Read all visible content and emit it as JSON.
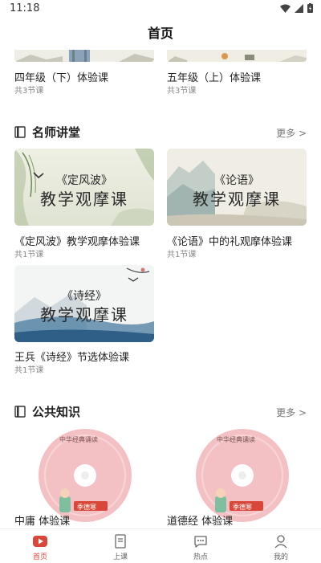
{
  "status": {
    "time": "11:18"
  },
  "header": {
    "title": "首页"
  },
  "top_cards": [
    {
      "title": "四年级（下）体验课",
      "sub": "共3节课"
    },
    {
      "title": "五年级（上）体验课",
      "sub": "共3节课"
    }
  ],
  "section1": {
    "name": "名师讲堂",
    "more": "更多 >",
    "cards": [
      {
        "poem": "《定风波》",
        "caption": "教学观摩课",
        "title": "《定风波》教学观摩体验课",
        "sub": "共1节课"
      },
      {
        "poem": "《论语》",
        "caption": "教学观摩课",
        "title": "《论语》中的礼观摩体验课",
        "sub": "共1节课"
      },
      {
        "poem": "《诗经》",
        "caption": "教学观摩课",
        "title": "王兵《诗经》节选体验课",
        "sub": "共1节课"
      }
    ]
  },
  "section2": {
    "name": "公共知识",
    "more": "更多 >",
    "cards": [
      {
        "title": "中庸 体验课",
        "disc_text": "中华经典诵读",
        "badge": "季德寒"
      },
      {
        "title": "道德经 体验课",
        "disc_text": "中华经典诵读",
        "badge": "季德寒"
      }
    ]
  },
  "nav": [
    {
      "label": "首页",
      "icon": "play-icon",
      "active": true
    },
    {
      "label": "上课",
      "icon": "book-icon"
    },
    {
      "label": "热点",
      "icon": "chat-icon"
    },
    {
      "label": "我的",
      "icon": "user-icon"
    }
  ],
  "colors": {
    "accent": "#d9473a",
    "ink": "#2a2a2a"
  }
}
